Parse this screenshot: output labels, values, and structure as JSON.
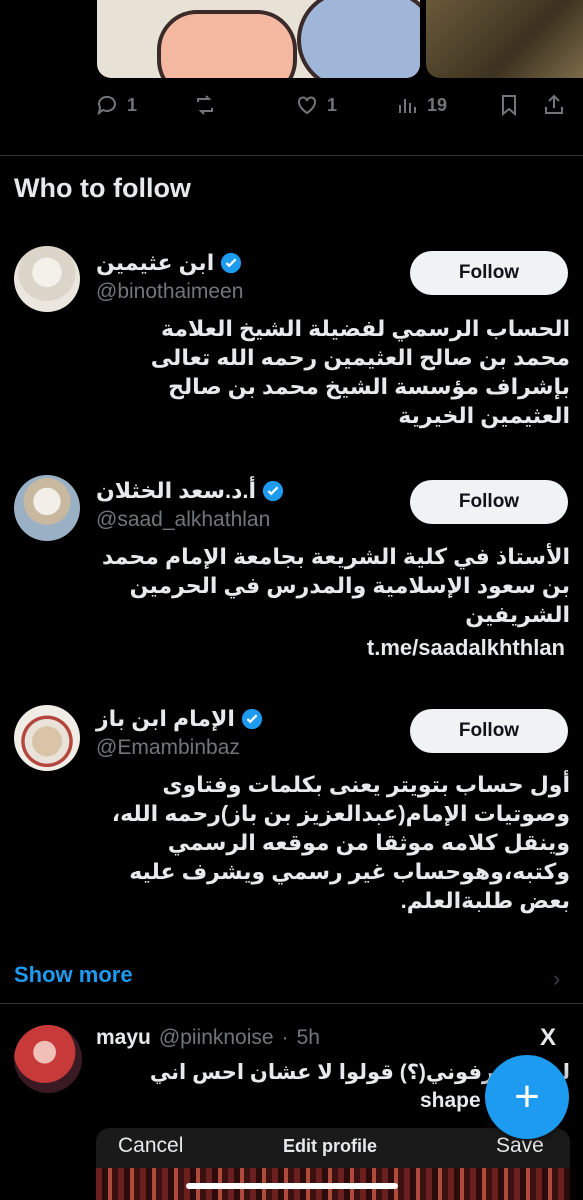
{
  "tweet_actions": {
    "replies": "1",
    "likes": "1",
    "views": "19"
  },
  "who_to_follow": {
    "title": "Who to follow",
    "suggestions": [
      {
        "name": "ابن عثيمين",
        "handle": "@binothaimeen",
        "follow_label": "Follow",
        "bio_lines": [
          "الحساب الرسمي لفضيلة الشيخ العلامة",
          "محمد بن صالح العثيمين رحمه الله تعالى",
          "بإشراف مؤسسة الشيخ محمد بن صالح",
          "العثيمين الخيرية"
        ]
      },
      {
        "name": "أ.د.سعد الخثلان",
        "handle": "@saad_alkhathlan",
        "follow_label": "Follow",
        "bio_lines": [
          "الأستاذ في كلية الشريعة بجامعة الإمام محمد",
          "بن سعود الإسلامية والمدرس في الحرمين",
          "الشريفين"
        ],
        "link": "t.me/saadalkhthlan"
      },
      {
        "name": "الإمام ابن باز",
        "handle": "@Emambinbaz",
        "follow_label": "Follow",
        "bio_lines": [
          "أول حساب بتويتر يعنى بكلمات وفتاوى",
          "وصوتيات الإمام(عبدالعزيز بن باز)رحمه الله،",
          "وينقل كلامه موثقا من موقعه الرسمي",
          "وكتبه،وهوحساب غير رسمي ويشرف عليه",
          "بعض طلبةالعلم."
        ]
      }
    ],
    "show_more": "Show more"
  },
  "next_tweet": {
    "name": "mayu",
    "handle": "@piinknoise",
    "time": "5h",
    "text_line1": "لـ  ـه بتعرفوني(؟) قولوا لا عشان احس اني",
    "text_line2": "shape",
    "embed": {
      "cancel": "Cancel",
      "title": "Edit profile",
      "save": "Save"
    }
  },
  "fab_label": "+",
  "colors": {
    "accent": "#1d9bf0",
    "verified": "#1d9bf0",
    "background": "#000000",
    "secondary_text": "#71767b"
  }
}
